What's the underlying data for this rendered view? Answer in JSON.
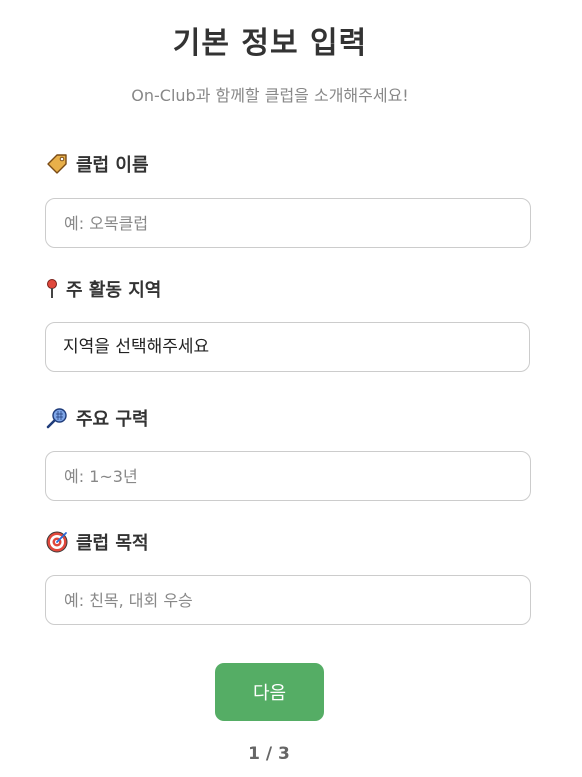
{
  "header": {
    "title": "기본 정보 입력",
    "subtitle": "On-Club과 함께할 클럽을 소개해주세요!"
  },
  "form": {
    "club_name": {
      "icon": "tag-icon",
      "label": "클럽 이름",
      "placeholder": "예: 오목클럽"
    },
    "region": {
      "icon": "pin-icon",
      "label": "주 활동 지역",
      "selected": "지역을 선택해주세요",
      "options": [
        "지역을 선택해주세요"
      ]
    },
    "experience": {
      "icon": "racket-icon",
      "label": "주요 구력",
      "placeholder": "예: 1~3년"
    },
    "purpose": {
      "icon": "target-icon",
      "label": "클럽 목적",
      "placeholder": "예: 친목, 대회 우승"
    }
  },
  "actions": {
    "next_label": "다음"
  },
  "progress": {
    "text": "1 / 3",
    "current_step": 1,
    "total_steps": 3
  },
  "colors": {
    "accent": "#55ad65",
    "title": "#333333",
    "subtitle": "#888888",
    "border": "#cccccc"
  }
}
